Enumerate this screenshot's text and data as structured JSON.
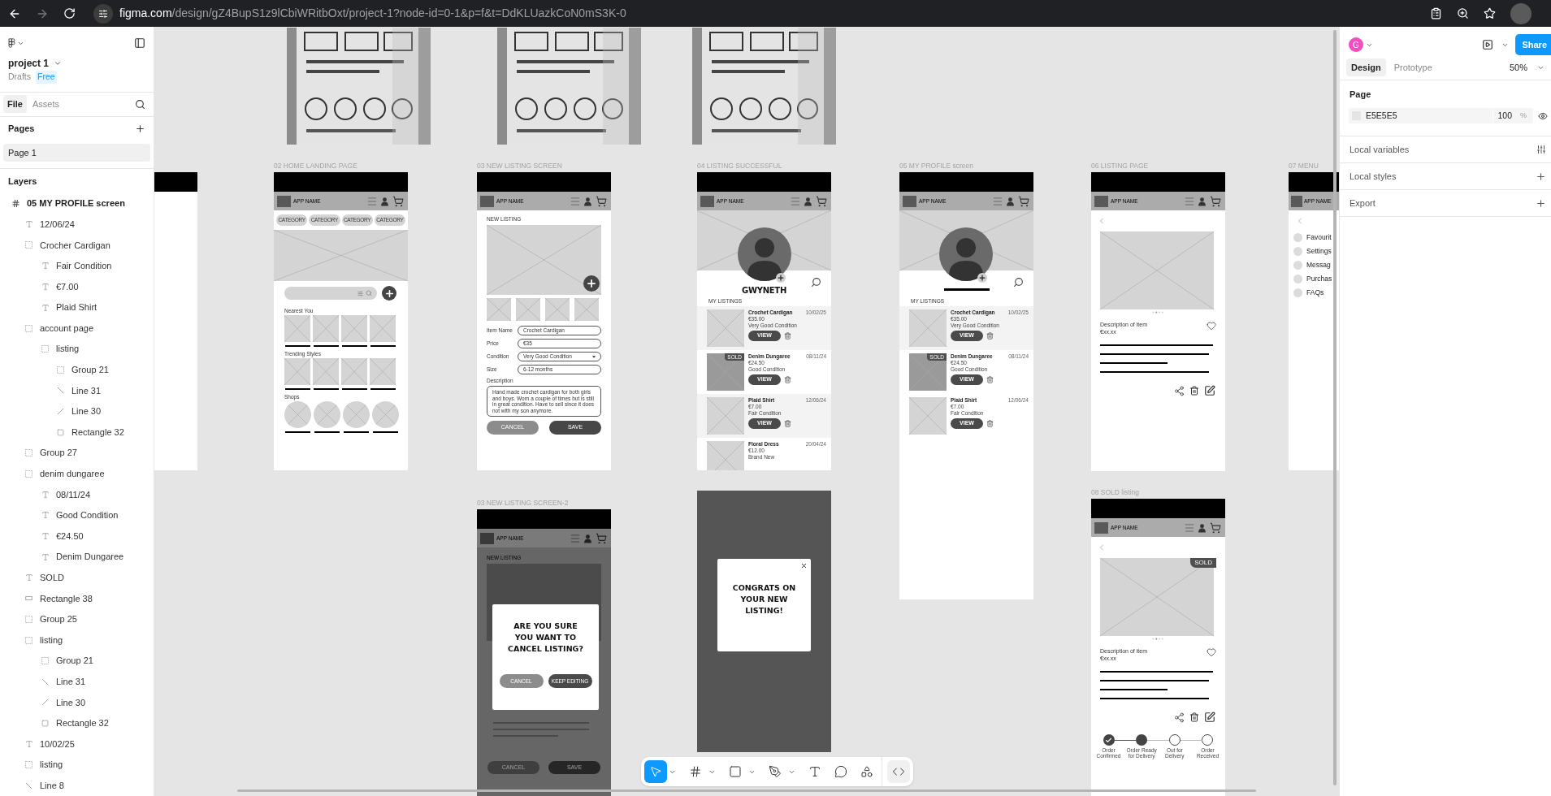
{
  "browser": {
    "domain": "figma.com",
    "path": "/design/gZ4BupS1z9lCbiWRitbOxt/project-1?node-id=0-1&p=f&t=DdKLUazkCoN0mS3K-0"
  },
  "left_panel": {
    "project": "project 1",
    "drafts": "Drafts",
    "plan": "Free",
    "tabs": [
      {
        "label": "File",
        "selected": true
      },
      {
        "label": "Assets",
        "selected": false
      }
    ],
    "pages_title": "Pages",
    "pages": [
      {
        "label": "Page 1",
        "selected": true
      }
    ],
    "layers_title": "Layers",
    "layers": [
      {
        "label": "05 MY PROFILE screen",
        "kind": "frame",
        "children": [
          {
            "label": "12/06/24",
            "kind": "text"
          },
          {
            "label": "Crocher Cardigan",
            "kind": "group",
            "children": [
              {
                "label": "Fair Condition",
                "kind": "text"
              },
              {
                "label": "€7.00",
                "kind": "text"
              },
              {
                "label": "Plaid Shirt",
                "kind": "text"
              }
            ]
          },
          {
            "label": "account page",
            "kind": "group",
            "children": [
              {
                "label": "listing",
                "kind": "group",
                "children": [
                  {
                    "label": "Group 21",
                    "kind": "group"
                  },
                  {
                    "label": "Line 31",
                    "kind": "line"
                  },
                  {
                    "label": "Line 30",
                    "kind": "line-up"
                  },
                  {
                    "label": "Rectangle 32",
                    "kind": "rect"
                  }
                ]
              }
            ]
          },
          {
            "label": "Group 27",
            "kind": "group"
          },
          {
            "label": "denim dungaree",
            "kind": "group",
            "children": [
              {
                "label": "08/11/24",
                "kind": "text"
              },
              {
                "label": "Good Condition",
                "kind": "text"
              },
              {
                "label": "€24.50",
                "kind": "text"
              },
              {
                "label": "Denim Dungaree",
                "kind": "text"
              }
            ]
          },
          {
            "label": "SOLD",
            "kind": "text"
          },
          {
            "label": "Rectangle 38",
            "kind": "bar"
          },
          {
            "label": "Group 25",
            "kind": "group"
          },
          {
            "label": "listing",
            "kind": "group",
            "children": [
              {
                "label": "Group 21",
                "kind": "group"
              },
              {
                "label": "Line 31",
                "kind": "line"
              },
              {
                "label": "Line 30",
                "kind": "line-up"
              },
              {
                "label": "Rectangle 32",
                "kind": "rect"
              }
            ]
          },
          {
            "label": "10/02/25",
            "kind": "text"
          },
          {
            "label": "listing",
            "kind": "group"
          },
          {
            "label": "Line 8",
            "kind": "line"
          }
        ]
      }
    ]
  },
  "right_panel": {
    "avatar": "G",
    "share": "Share",
    "tabs": [
      {
        "label": "Design",
        "selected": true
      },
      {
        "label": "Prototype",
        "selected": false
      }
    ],
    "zoom": "50%",
    "page_title": "Page",
    "page_color": "E5E5E5",
    "opacity": "100",
    "opacity_unit": "%",
    "sections": [
      {
        "label": "Local variables",
        "kind": "variables"
      },
      {
        "label": "Local styles",
        "kind": "add"
      },
      {
        "label": "Export",
        "kind": "add"
      }
    ]
  },
  "canvas": {
    "frames": [
      {
        "kind": "picture"
      },
      {
        "kind": "picture"
      },
      {
        "kind": "picture"
      },
      {
        "kind": "partial"
      },
      {
        "kind": "home",
        "title": "02 HOME LANDING PAGE",
        "app_name": "APP NAME",
        "categories": [
          "CATEGORY",
          "CATEGORY",
          "CATEGORY",
          "CATEGORY"
        ],
        "sections": [
          {
            "label": "Nearest You",
            "kind": "square"
          },
          {
            "label": "Trending Styles",
            "kind": "square"
          },
          {
            "label": "Shops",
            "kind": "circle"
          }
        ]
      },
      {
        "kind": "new_listing",
        "title": "03 NEW LISTING SCREEN",
        "app_name": "APP NAME",
        "heading": "NEW LISTING",
        "fields": [
          {
            "label": "Item Name",
            "value": "Crochet Cardigan",
            "kind": "text"
          },
          {
            "label": "Price",
            "value": "€35",
            "kind": "text"
          },
          {
            "label": "Condition",
            "value": "Very Good Condition",
            "kind": "select"
          },
          {
            "label": "Size",
            "value": "6-12 months",
            "kind": "text"
          }
        ],
        "description_label": "Description",
        "description": "Hand made crochet cardigan for both girls and boys. Worn a couple of times but is still in great condition. Have to sell since it does not with my son anymore.",
        "buttons": [
          {
            "label": "CANCEL",
            "kind": "secondary"
          },
          {
            "label": "SAVE",
            "kind": "primary"
          }
        ]
      },
      {
        "kind": "profile",
        "title": "04 LISTING SUCCESSFUL",
        "app_name": "APP NAME",
        "name": "GWYNETH",
        "section": "MY LISTINGS",
        "listings": [
          {
            "name": "Crochet Cardigan",
            "date": "10/02/25",
            "price": "€35.00",
            "condition": "Very Good Condition",
            "sold": false,
            "shaded": true,
            "button": "VIEW"
          },
          {
            "name": "Denim Dungaree",
            "date": "08/11/24",
            "price": "€24.50",
            "condition": "Good Condition",
            "sold": true,
            "badge": "SOLD",
            "shaded": false,
            "button": "VIEW"
          },
          {
            "name": "Plaid Shirt",
            "date": "12/06/24",
            "price": "€7.00",
            "condition": "Fair Condition",
            "sold": false,
            "shaded": true,
            "button": "VIEW"
          },
          {
            "name": "Floral Dress",
            "date": "20/04/24",
            "price": "€12.00",
            "condition": "Brand New",
            "sold": false,
            "shaded": false
          }
        ]
      },
      {
        "kind": "profile",
        "title": "05 MY PROFILE screen",
        "app_name": "APP NAME",
        "section": "MY LISTINGS",
        "listings": [
          {
            "name": "Crochet Cardigan",
            "date": "10/02/25",
            "price": "€35.00",
            "condition": "Very Good Condition",
            "sold": false,
            "shaded": true,
            "button": "VIEW"
          },
          {
            "name": "Denim Dungaree",
            "date": "08/11/24",
            "price": "€24.50",
            "condition": "Good Condition",
            "sold": true,
            "badge": "SOLD",
            "shaded": false,
            "button": "VIEW"
          },
          {
            "name": "Plaid Shirt",
            "date": "12/06/24",
            "price": "€7.00",
            "condition": "Fair Condition",
            "sold": false,
            "shaded": false,
            "button": "VIEW"
          }
        ]
      },
      {
        "kind": "listing",
        "title": "06 LISTING PAGE",
        "app_name": "APP NAME",
        "description": "Description of item",
        "price": "€xx.xx"
      },
      {
        "kind": "menu",
        "title": "07 MENU",
        "app_name": "APP NAME",
        "items": [
          "Favourit",
          "Settings",
          "Messag",
          "Purchas",
          "FAQs"
        ]
      },
      {
        "kind": "cancel_dialog",
        "title": "03 NEW LISTING SCREEN-2",
        "app_name": "APP NAME",
        "heading": "NEW LISTING",
        "question": "ARE YOU SURE YOU WANT TO CANCEL LISTING?",
        "buttons": [
          {
            "label": "CANCEL",
            "kind": "secondary"
          },
          {
            "label": "KEEP EDITING",
            "kind": "primary"
          }
        ],
        "background_buttons": [
          "CANCEL",
          "SAVE"
        ]
      },
      {
        "kind": "congrats",
        "message": "CONGRATS ON YOUR NEW LISTING!"
      },
      {
        "kind": "listing",
        "title": "08 SOLD listing",
        "app_name": "APP NAME",
        "description": "Description of item",
        "price": "€xx.xx",
        "badge": "SOLD",
        "steps": [
          {
            "label": "Order Confirmed",
            "checked": true,
            "filled": true
          },
          {
            "label": "Order Ready for Delivery",
            "checked": false,
            "filled": true
          },
          {
            "label": "Out for Delivery",
            "checked": false,
            "filled": false
          },
          {
            "label": "Order Received",
            "checked": false,
            "filled": false
          }
        ]
      }
    ],
    "toolbar": [
      {
        "kind": "move",
        "selected": true
      },
      {
        "kind": "frame",
        "selected": false
      },
      {
        "kind": "rect",
        "selected": false
      },
      {
        "kind": "pen",
        "selected": false
      },
      {
        "kind": "text",
        "selected": false
      },
      {
        "kind": "comment",
        "selected": false
      },
      {
        "kind": "actions",
        "selected": false
      },
      {
        "kind": "code",
        "selected": false
      }
    ]
  }
}
